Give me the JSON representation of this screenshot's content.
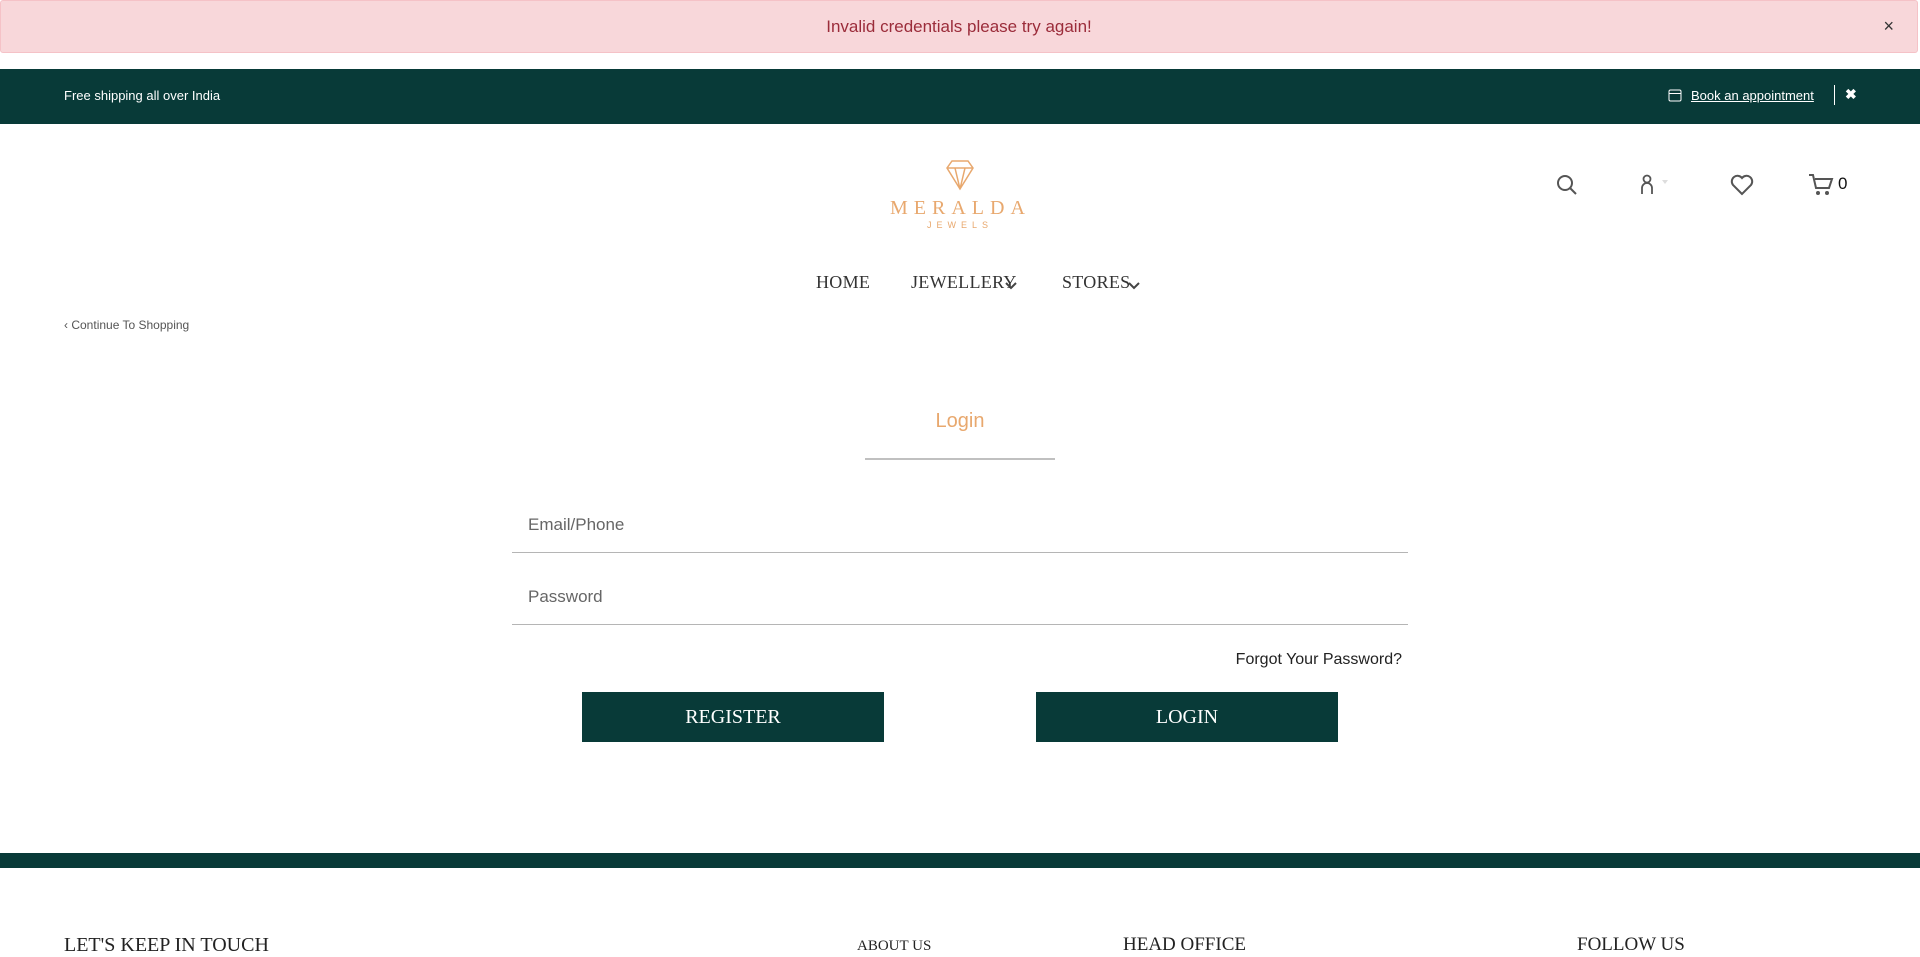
{
  "alert": {
    "message": "Invalid credentials please try again!",
    "close": "×"
  },
  "topbar": {
    "shipping": "Free shipping all over India",
    "appointment": "Book an appointment",
    "close": "✖"
  },
  "brand": {
    "name": "MERALDA",
    "sub": "JEWELS"
  },
  "header": {
    "cart_count": "0"
  },
  "nav": {
    "items": [
      {
        "label": "HOME"
      },
      {
        "label": "JEWELLERY"
      },
      {
        "label": "STORES"
      }
    ]
  },
  "back_link": "Continue To Shopping",
  "login": {
    "tab": "Login",
    "email_placeholder": "Email/Phone",
    "password_placeholder": "Password",
    "forgot": "Forgot Your Password?",
    "register_btn": "REGISTER",
    "login_btn": "LOGIN"
  },
  "footer": {
    "touch": "LET'S KEEP IN TOUCH",
    "about": "ABOUT US",
    "office": "HEAD OFFICE",
    "follow": "FOLLOW US"
  },
  "colors": {
    "brand_green": "#083a38",
    "accent": "#e8a86e",
    "alert_bg": "#f8d7da"
  }
}
